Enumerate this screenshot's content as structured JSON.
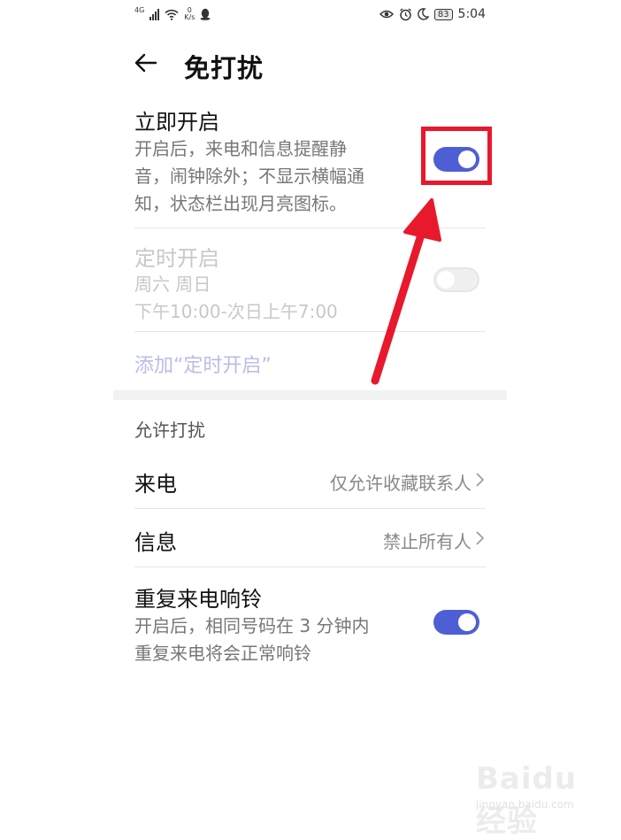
{
  "status_bar": {
    "signal_label": "4G",
    "net_speed_value": "0",
    "net_speed_unit": "K/s",
    "battery": "83",
    "time": "5:04"
  },
  "header": {
    "title": "免打扰",
    "back_icon": "arrow-left-icon"
  },
  "immediate": {
    "title": "立即开启",
    "desc_lines": [
      "开启后，来电和信息提醒静",
      "音，闹钟除外；不显示横幅通",
      "知，状态栏出现月亮图标。"
    ],
    "enabled": true
  },
  "scheduled": {
    "title": "定时开启",
    "days": "周六 周日",
    "time_range": "下午10:00-次日上午7:00",
    "enabled": false
  },
  "add_schedule_link": "添加“定时开启”",
  "allow_section": {
    "label": "允许打扰",
    "calls": {
      "label": "来电",
      "value": "仅允许收藏联系人"
    },
    "messages": {
      "label": "信息",
      "value": "禁止所有人"
    },
    "repeat_calls": {
      "title": "重复来电响铃",
      "desc_lines": [
        "开启后，相同号码在 3 分钟内",
        "重复来电将会正常响铃"
      ],
      "enabled": true
    }
  },
  "watermark": {
    "brand": "Baidu经验",
    "sub": "jingyan.baidu.com"
  },
  "colors": {
    "accent": "#4e5fd6",
    "annotation": "#e8192c",
    "link_muted": "#b8bde6"
  }
}
